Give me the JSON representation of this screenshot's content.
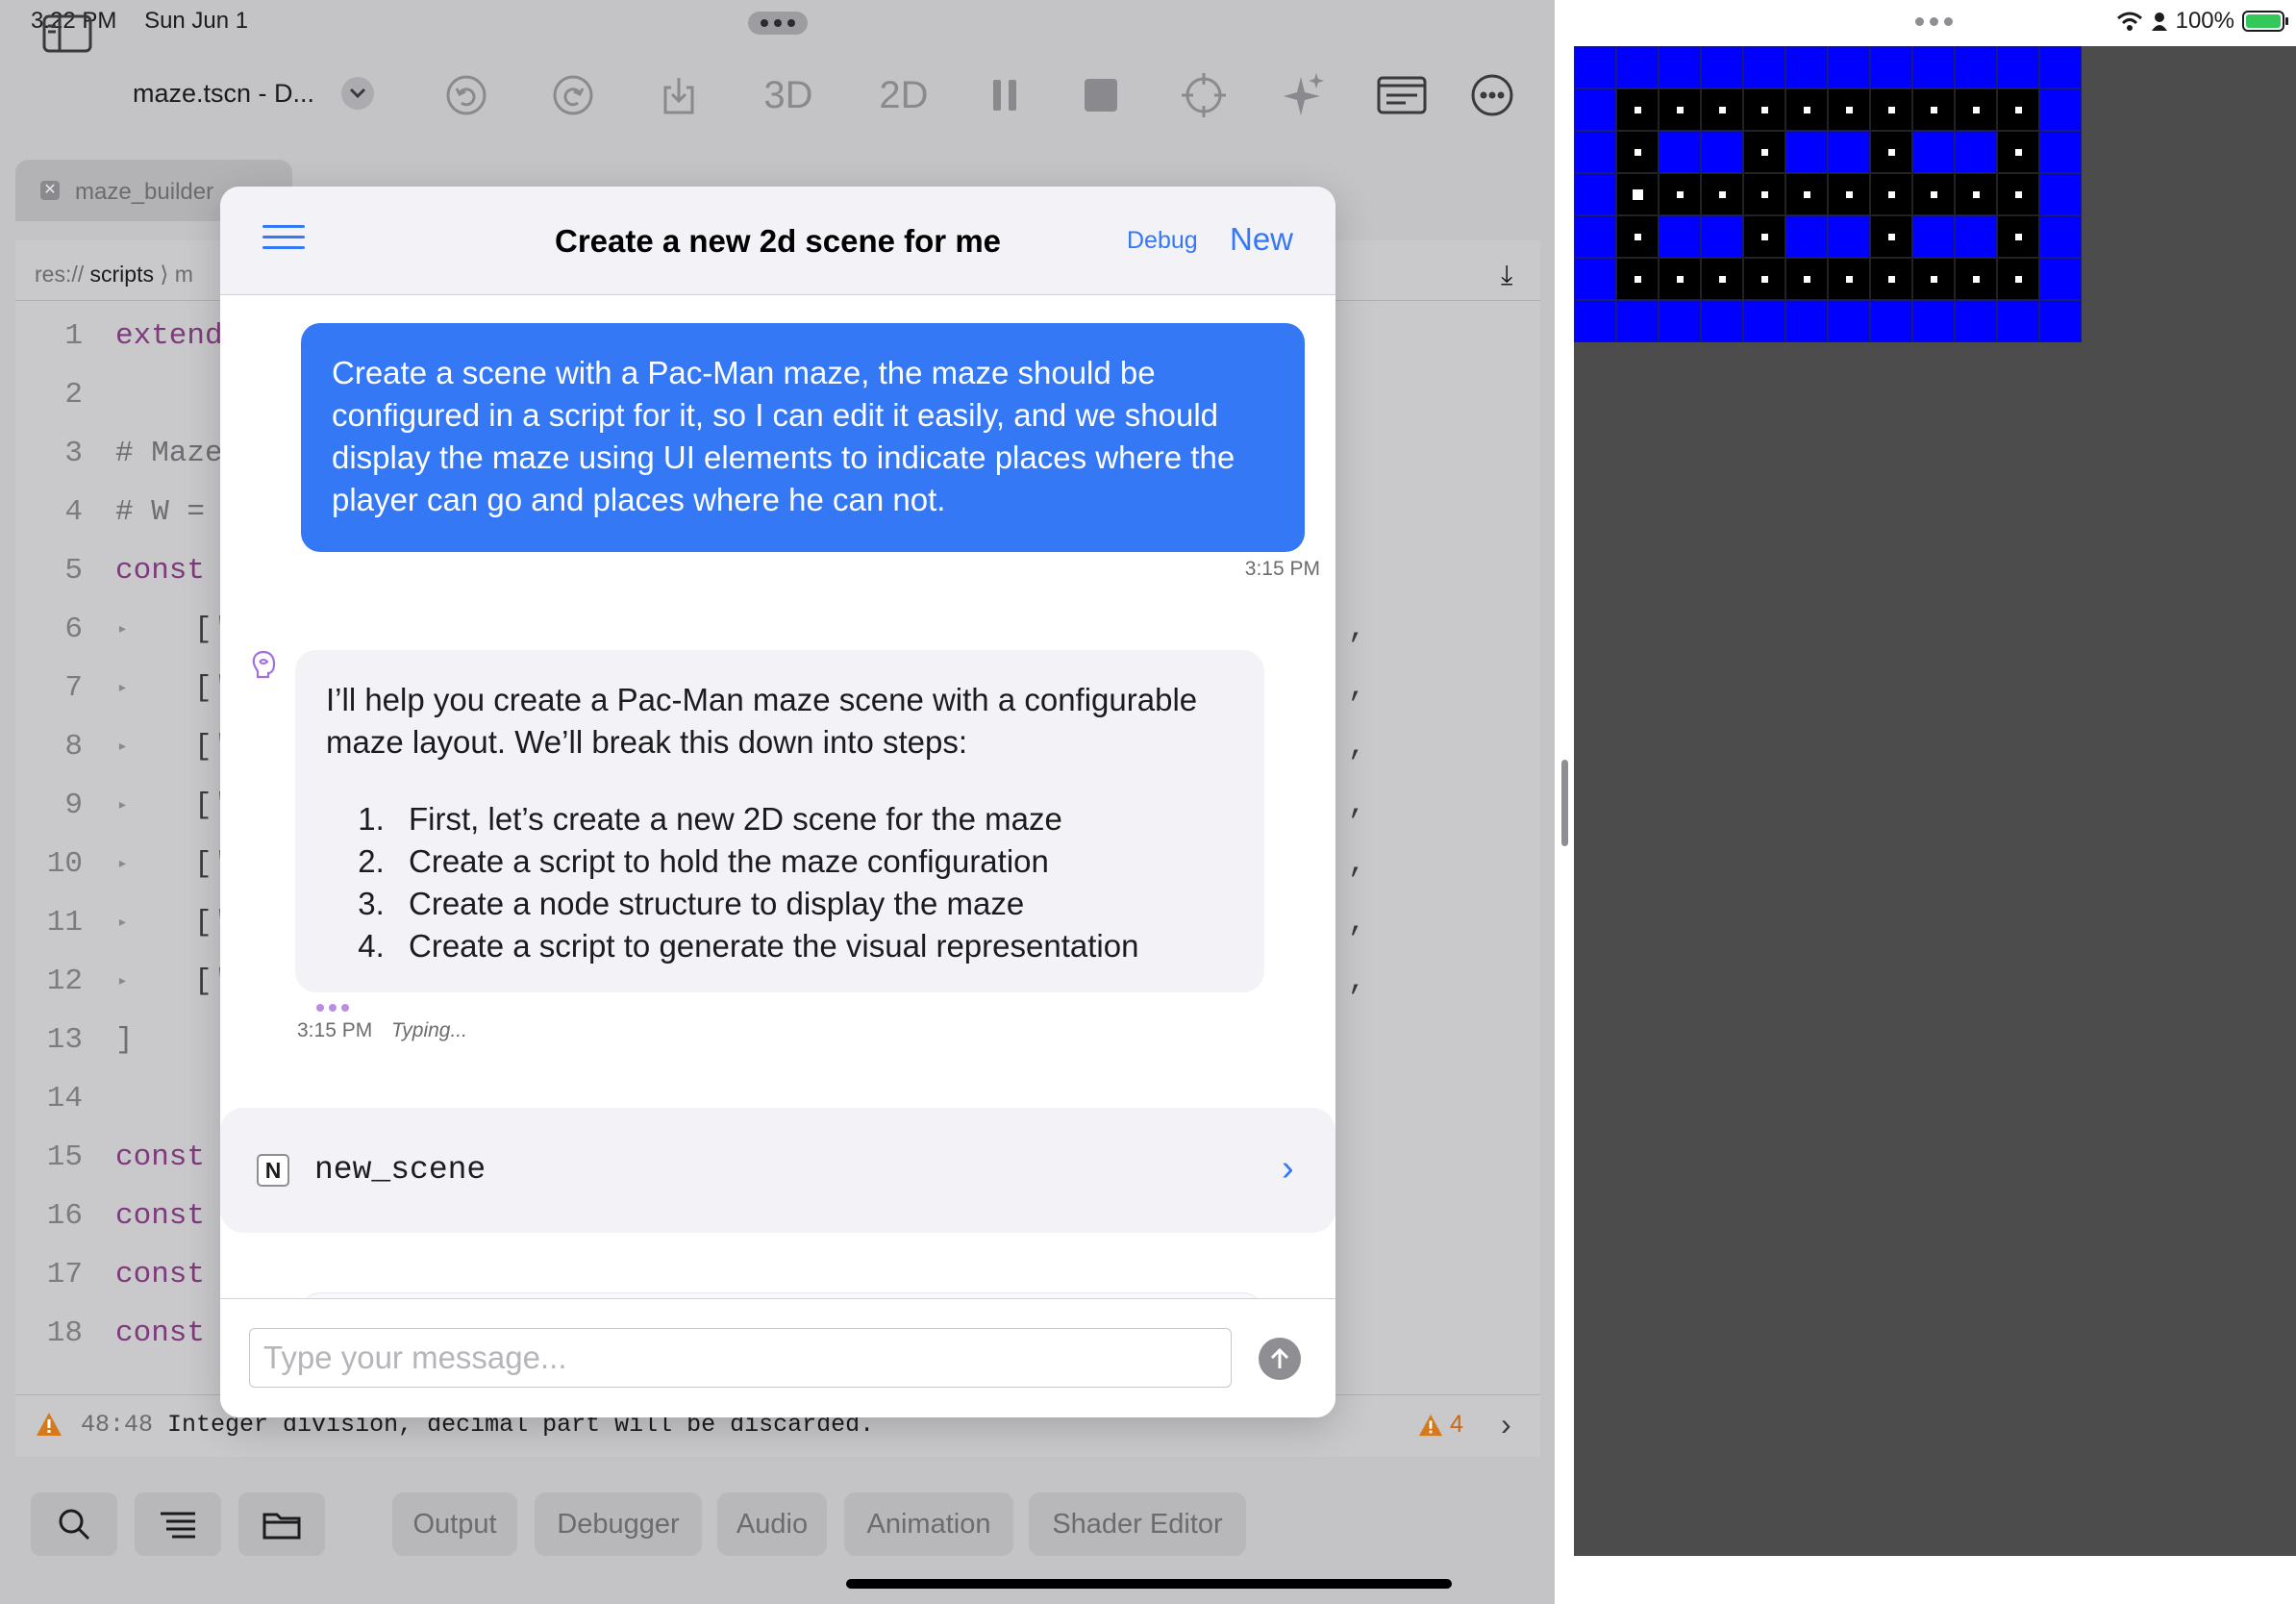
{
  "statusbar": {
    "time": "3:22 PM",
    "date": "Sun Jun 1"
  },
  "toolbar": {
    "filename": "maze.tscn - D...",
    "btn_3d": "3D",
    "btn_2d": "2D",
    "icons": [
      "sidebar-icon",
      "undo-icon",
      "redo-icon",
      "download-icon",
      "pause-icon",
      "stop-icon",
      "crosshair-icon",
      "sparkle-icon",
      "window-icon",
      "more-icon"
    ]
  },
  "tab": {
    "label": "maze_builder"
  },
  "pathbar": {
    "prefix": "res://",
    "folder": "scripts",
    "separator": "⟩",
    "file_start": "m"
  },
  "code": {
    "lines": [
      {
        "n": "1",
        "kind": "kw",
        "text": "extend"
      },
      {
        "n": "2",
        "kind": "none",
        "text": ""
      },
      {
        "n": "3",
        "kind": "cm",
        "text": "# Maze"
      },
      {
        "n": "4",
        "kind": "cm",
        "text": "# W ="
      },
      {
        "n": "5",
        "kind": "kw",
        "text": "const"
      },
      {
        "n": "6",
        "kind": "row",
        "text": "['"
      },
      {
        "n": "7",
        "kind": "row",
        "text": "['"
      },
      {
        "n": "8",
        "kind": "row",
        "text": "['"
      },
      {
        "n": "9",
        "kind": "row",
        "text": "['"
      },
      {
        "n": "10",
        "kind": "row",
        "text": "['"
      },
      {
        "n": "11",
        "kind": "row",
        "text": "['"
      },
      {
        "n": "12",
        "kind": "row",
        "text": "['"
      },
      {
        "n": "13",
        "kind": "cm",
        "text": "]"
      },
      {
        "n": "14",
        "kind": "none",
        "text": ""
      },
      {
        "n": "15",
        "kind": "kw",
        "text": "const"
      },
      {
        "n": "16",
        "kind": "kw",
        "text": "const"
      },
      {
        "n": "17",
        "kind": "kw",
        "text": "const"
      },
      {
        "n": "18",
        "kind": "kw",
        "text": "const"
      }
    ]
  },
  "warning": {
    "location": "48:48",
    "message": "Integer division, decimal part will be discarded.",
    "count": "4"
  },
  "bottom_tabs": [
    "Output",
    "Debugger",
    "Audio",
    "Animation",
    "Shader Editor"
  ],
  "chat": {
    "title": "Create a new 2d scene for me",
    "debug_label": "Debug",
    "new_label": "New",
    "user_message": "Create a scene with a Pac-Man maze, the maze should be configured in a script for it, so I can edit it easily, and we should display the maze using UI elements to indicate places where the player can go and places where he can not.",
    "user_time": "3:15 PM",
    "ai_intro": "I’ll help you create a Pac-Man maze scene with a configurable maze layout. We’ll break this down into steps:",
    "ai_steps": [
      "First, let’s create a new 2D scene for the maze",
      "Create a script to hold the maze configuration",
      "Create a node structure to display the maze",
      "Create a script to generate the visual representation"
    ],
    "ai_time": "3:15 PM",
    "typing": "Typing...",
    "tool_badge": "N",
    "tool_name": "new_scene",
    "input_placeholder": "Type your message..."
  },
  "game_status": {
    "battery": "100%"
  },
  "maze": {
    "rows": [
      "WWWWWWWWWWWW",
      "WPPPPPPPPPPW",
      "WPWWPWWPWWPW",
      "WOPPPPPPPPPW",
      "WPWWPWWPWWPW",
      "WPPPPPPPPPPW",
      "WWWWWWWWWWWW"
    ],
    "wall_color": "#0000ff",
    "path_color": "#000000",
    "dot_color": "#ffffff"
  },
  "colors": {
    "accent": "#3478f6",
    "warning": "#c66a1a",
    "keyword": "#7e3a7c"
  }
}
